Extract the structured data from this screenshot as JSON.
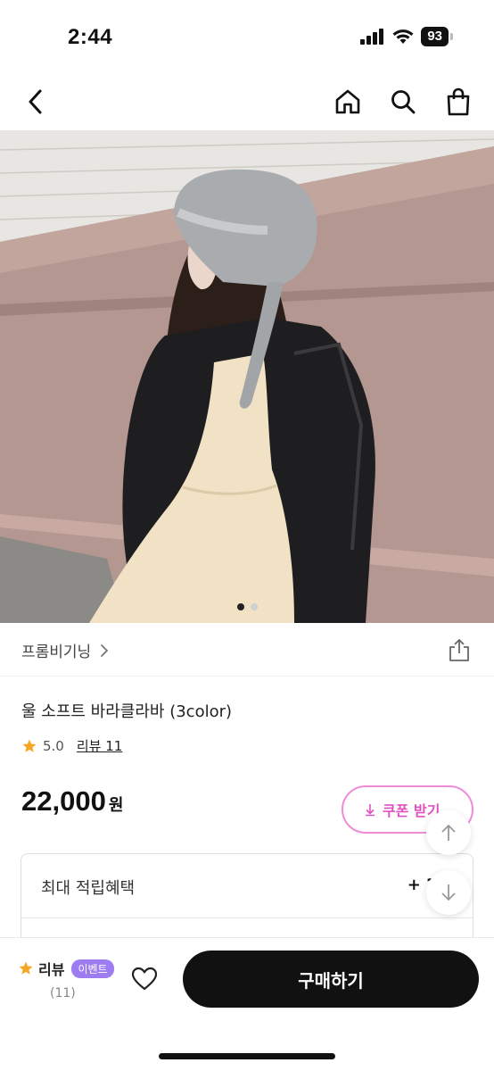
{
  "status_bar": {
    "time": "2:44",
    "battery": "93"
  },
  "nav": {
    "back_icon": "chevron-left-icon",
    "home_icon": "home-icon",
    "search_icon": "search-icon",
    "cart_icon": "shopping-bag-icon"
  },
  "gallery": {
    "current_page": 1,
    "total_pages": 2
  },
  "brand": {
    "name": "프롬비기닝"
  },
  "product": {
    "title": "울 소프트 바라클라바 (3color)",
    "rating": "5.0",
    "review_link": "리뷰 11",
    "price": "22,000",
    "currency": "원"
  },
  "coupon": {
    "label": "쿠폰 받기"
  },
  "benefit": {
    "label": "최대 적립혜택",
    "value": "+ 2,2"
  },
  "bottom_bar": {
    "review_label": "리뷰",
    "event_badge": "이벤트",
    "review_count": "(11)",
    "buy_label": "구매하기"
  },
  "colors": {
    "accent_pink": "#e052c0",
    "star": "#f5a623",
    "event_purple": "#9d7bf0",
    "buy_button": "#111111"
  }
}
